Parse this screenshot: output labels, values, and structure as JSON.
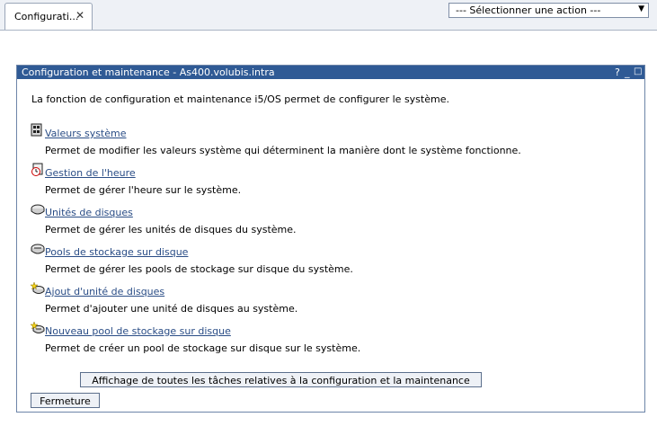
{
  "tab": {
    "label": "Configurati...",
    "close_symbol": "✕"
  },
  "action_select": {
    "value": "--- Sélectionner une action ---"
  },
  "portlet": {
    "title": "Configuration et maintenance - As400.volubis.intra",
    "help_symbol": "?",
    "minimize_symbol": "_",
    "maximize_symbol": "□",
    "intro": "La fonction de configuration et maintenance i5/OS permet de configurer le système.",
    "tasks": [
      {
        "icon": "system-values-icon",
        "label": "Valeurs système",
        "desc": "Permet de modifier les valeurs système qui déterminent la manière dont le système fonctionne."
      },
      {
        "icon": "clock-icon",
        "label": "Gestion de l'heure",
        "desc": "Permet de gérer l'heure sur le système."
      },
      {
        "icon": "disk-icon",
        "label": "Unités de disques",
        "desc": "Permet de gérer les unités de disques du système."
      },
      {
        "icon": "disk-pool-icon",
        "label": "Pools de stockage sur disque",
        "desc": "Permet de gérer les pools de stockage sur disque du système."
      },
      {
        "icon": "new-disk-icon",
        "label": "Ajout d'unité de disques",
        "desc": "Permet d'ajouter une unité de disques au système."
      },
      {
        "icon": "new-disk-pool-icon",
        "label": "Nouveau pool de stockage sur disque",
        "desc": "Permet de créer un pool de stockage sur disque sur le système."
      }
    ],
    "show_all_button": "Affichage de toutes les tâches relatives à la configuration et la maintenance",
    "close_button": "Fermeture"
  },
  "colors": {
    "title_bar": "#2f5a95",
    "link": "#2a4d86",
    "border": "#6d85a8"
  }
}
